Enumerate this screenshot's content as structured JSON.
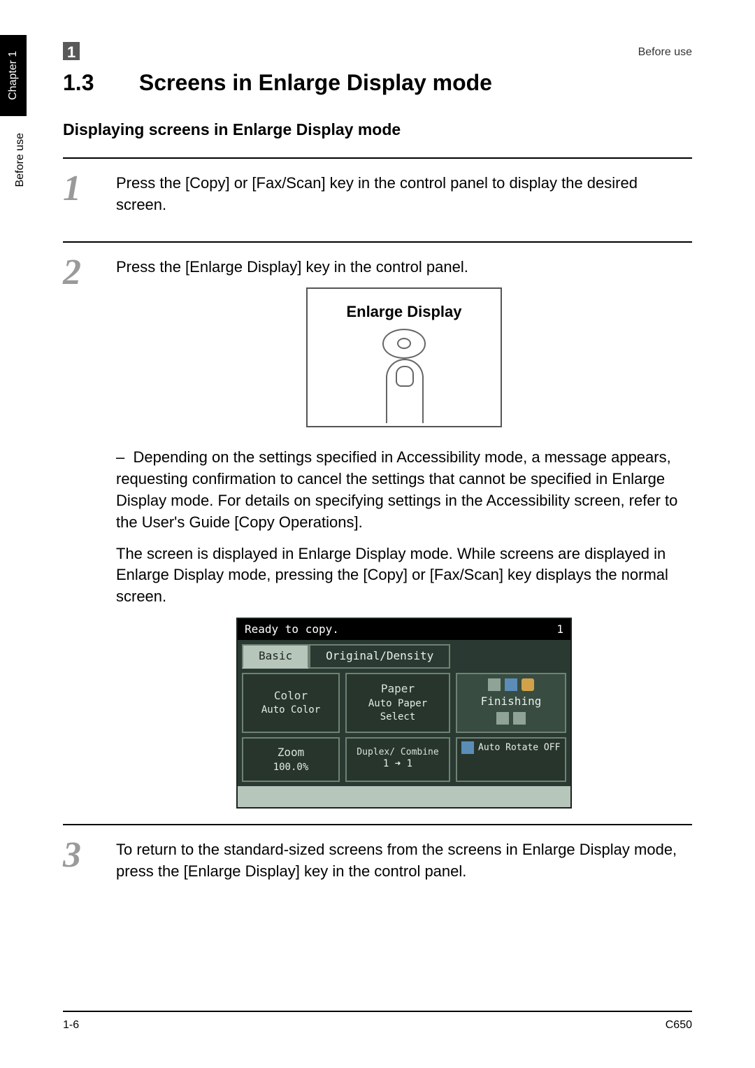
{
  "side": {
    "tab": "Chapter 1",
    "running": "Before use"
  },
  "header": {
    "chip": "1",
    "right": "Before use"
  },
  "title": {
    "number": "1.3",
    "text": "Screens in Enlarge Display mode"
  },
  "subtitle": "Displaying screens in Enlarge Display mode",
  "steps": {
    "s1": {
      "num": "1",
      "text": "Press the [Copy] or [Fax/Scan] key in the control panel to display the desired screen."
    },
    "s2": {
      "num": "2",
      "text": "Press the [Enlarge Display] key in the control panel.",
      "keylabel": "Enlarge Display",
      "note_dash": "–",
      "note": "Depending on the settings specified in Accessibility mode, a message appears, requesting confirmation to cancel the settings that cannot be specified in Enlarge Display mode. For details on specifying settings in the Accessibility screen, refer to the User's Guide [Copy Operations].",
      "after": "The screen is displayed in Enlarge Display mode. While screens are displayed in Enlarge Display mode, pressing the [Copy] or [Fax/Scan] key displays the normal screen."
    },
    "s3": {
      "num": "3",
      "text": "To return to the standard-sized screens from the screens in Enlarge Display mode, press the [Enlarge Display] key in the control panel."
    }
  },
  "lcd": {
    "status": "Ready to copy.",
    "count": "1",
    "tabs": {
      "basic": "Basic",
      "orig": "Original/Density"
    },
    "color": {
      "title": "Color",
      "value": "Auto Color"
    },
    "paper": {
      "title": "Paper",
      "value": "Auto Paper Select"
    },
    "zoom": {
      "title": "Zoom",
      "value": "100.0%"
    },
    "duplex": {
      "title": "Duplex/ Combine",
      "value": "1 ➜ 1"
    },
    "finishing": "Finishing",
    "autorotate": "Auto Rotate OFF"
  },
  "footer": {
    "left": "1-6",
    "right": "C650"
  }
}
